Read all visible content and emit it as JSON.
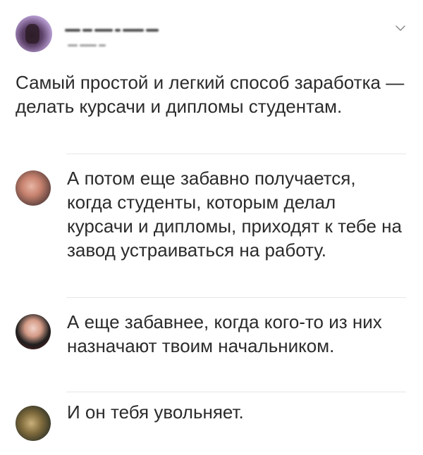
{
  "post": {
    "author_name": "",
    "author_handle": "",
    "text": "Самый простой и легкий способ заработка — делать курсачи и дипломы студентам."
  },
  "replies": [
    {
      "text": "А потом еще забавно получается, когда студенты, которым делал курсачи и дипломы, приходят к тебе на завод устраиваться на работу."
    },
    {
      "text": "А еще забавнее, когда кого-то из них назначают твоим начальником."
    },
    {
      "text": "И он тебя увольняет."
    }
  ],
  "icons": {
    "menu": "chevron-down-icon"
  },
  "colors": {
    "text": "#2b2b2b",
    "divider": "#e6e6e6",
    "background": "#ffffff"
  }
}
